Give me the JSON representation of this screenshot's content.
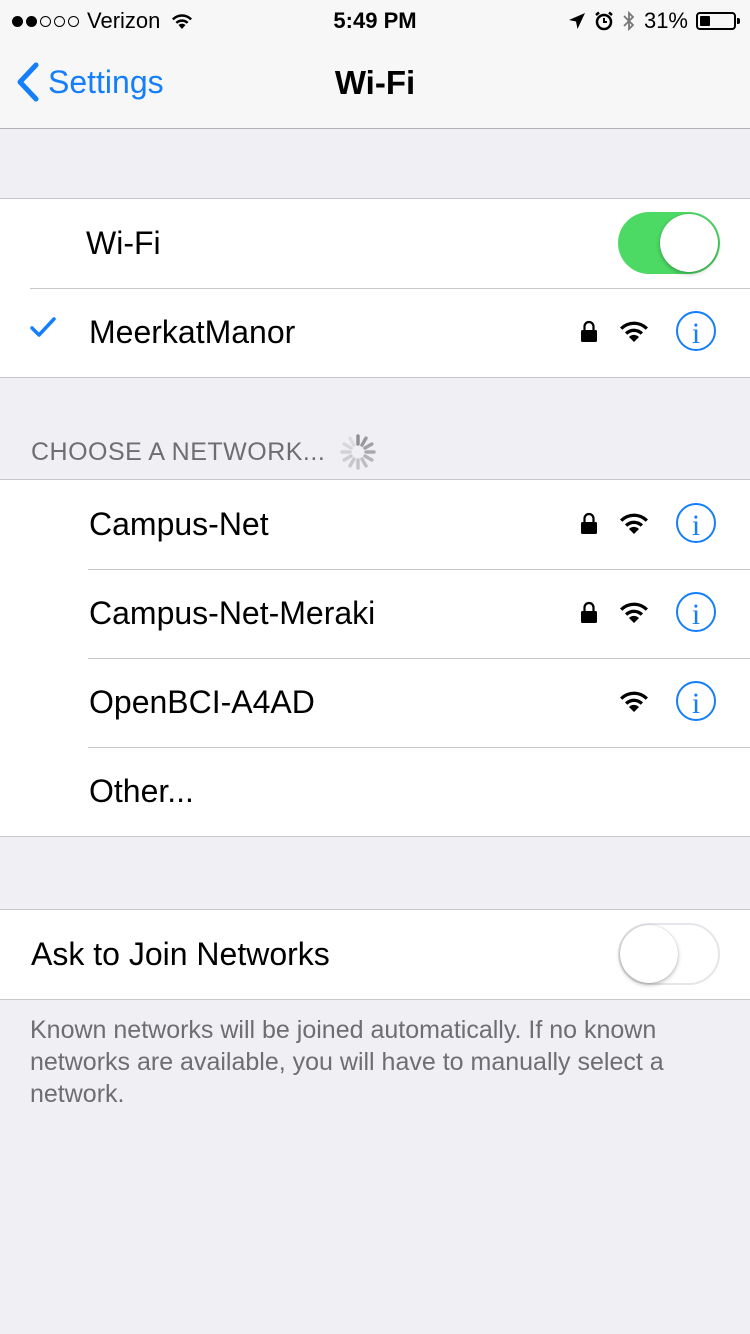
{
  "status_bar": {
    "signal_dots": [
      true,
      true,
      false,
      false,
      false
    ],
    "carrier": "Verizon",
    "time": "5:49 PM",
    "battery": "31%",
    "battery_level": 0.31,
    "icons": [
      "wifi-icon",
      "location-arrow-icon",
      "alarm-icon",
      "bluetooth-icon",
      "battery-icon"
    ]
  },
  "nav": {
    "back_label": "Settings",
    "title": "Wi-Fi"
  },
  "wifi_toggle": {
    "label": "Wi-Fi",
    "on": true
  },
  "connected": {
    "name": "MeerkatManor",
    "secured": true
  },
  "choose_header": "CHOOSE A NETWORK...",
  "networks": [
    {
      "name": "Campus-Net",
      "secured": true
    },
    {
      "name": "Campus-Net-Meraki",
      "secured": true
    },
    {
      "name": "OpenBCI-A4AD",
      "secured": false
    }
  ],
  "other_label": "Other...",
  "ask_to_join": {
    "label": "Ask to Join Networks",
    "on": false
  },
  "footer_text": "Known networks will be joined automatically. If no known networks are available, you will have to manually select a network.",
  "colors": {
    "accent": "#147efb",
    "toggle_on": "#4cd964",
    "background": "#efeff4"
  }
}
